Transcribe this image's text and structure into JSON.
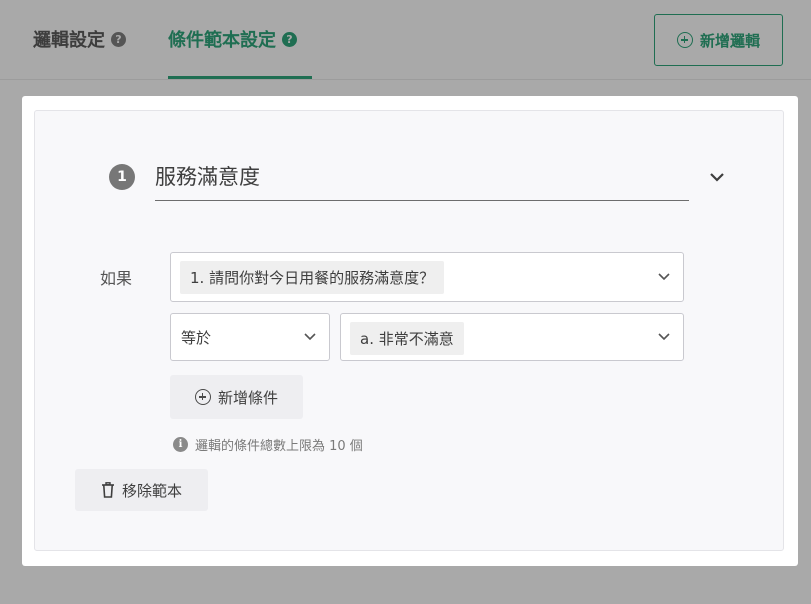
{
  "tabs": [
    {
      "label": "邏輯設定",
      "active": false
    },
    {
      "label": "條件範本設定",
      "active": true
    }
  ],
  "help_glyph": "?",
  "header": {
    "add_logic_label": "新增邏輯"
  },
  "template": {
    "number": "1",
    "title": "服務滿意度",
    "if_label": "如果",
    "question_value": "1. 請問你對今日用餐的服務滿意度？",
    "operator_value": "等於",
    "answer_value": "a. 非常不滿意",
    "add_condition_label": "新增條件",
    "limit_note": "邏輯的條件總數上限為 10 個",
    "remove_label": "移除範本"
  },
  "icons": {
    "help": "question-circle-icon",
    "add": "plus-circle-icon",
    "chevron": "chevron-down-icon",
    "info": "info-circle-icon",
    "trash": "trash-icon"
  },
  "colors": {
    "accent": "#1f6e52",
    "overlay": "#a9a9a9",
    "card": "#f8f8fa"
  }
}
